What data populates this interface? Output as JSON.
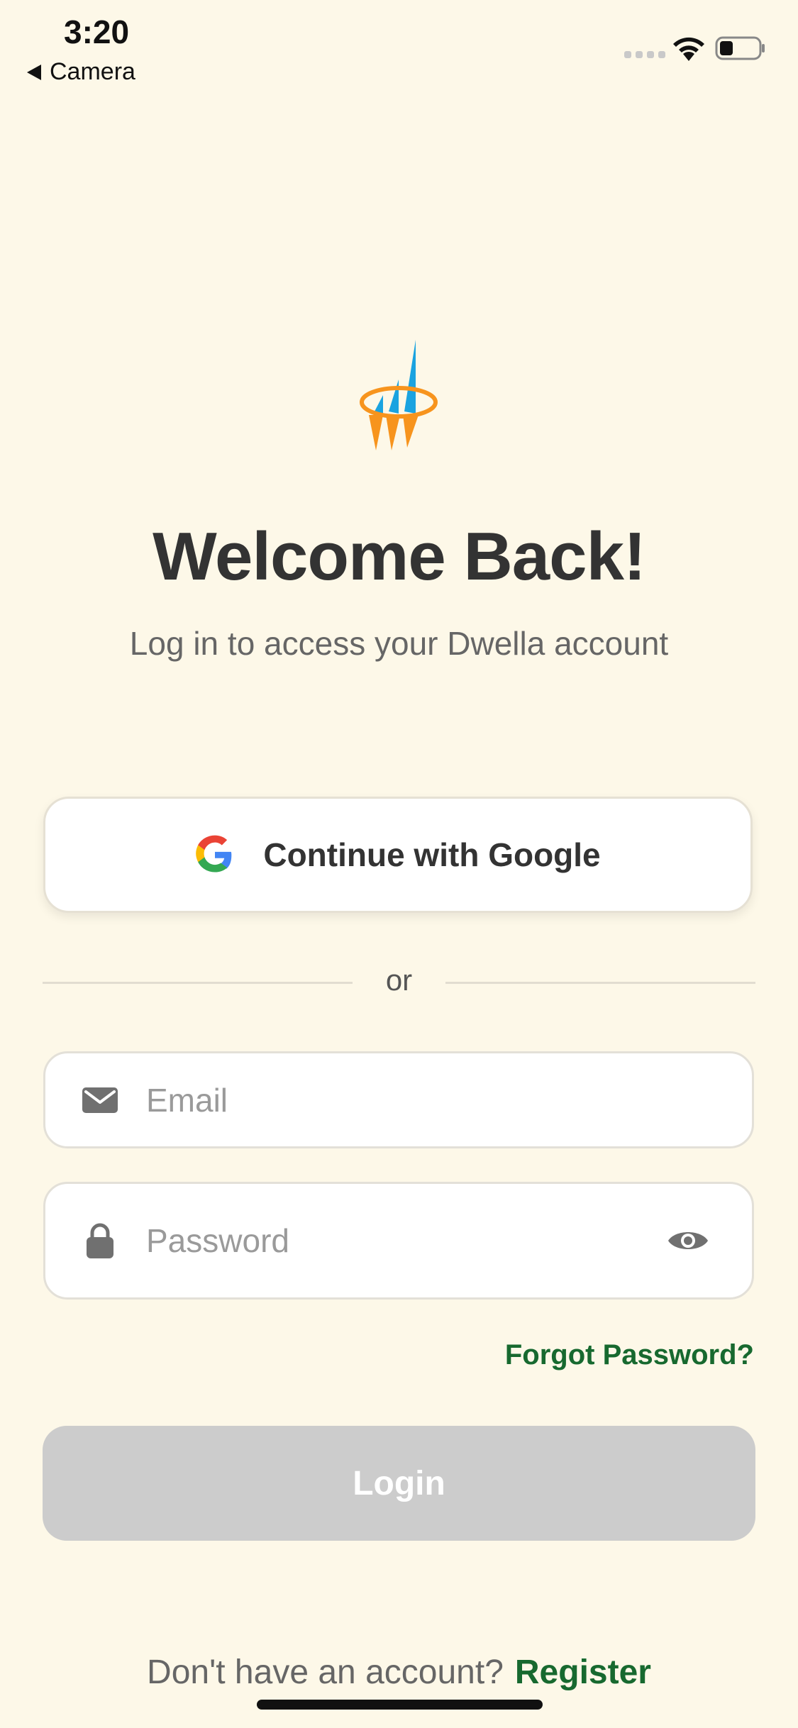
{
  "status_bar": {
    "time": "3:20",
    "back_label": "Camera",
    "battery_level": 0.35
  },
  "colors": {
    "background": "#fdf8e8",
    "accent_green": "#17692f",
    "login_disabled": "#cccccc",
    "logo_blue": "#1aa3e0",
    "logo_orange": "#f7941d"
  },
  "logo": {
    "icon": "dwella-logo"
  },
  "header": {
    "title": "Welcome Back!",
    "subtitle": "Log in to access your Dwella account"
  },
  "google_button": {
    "label": "Continue with Google",
    "icon": "google-icon"
  },
  "divider": {
    "label": "or"
  },
  "form": {
    "email": {
      "value": "",
      "placeholder": "Email",
      "icon": "mail-icon"
    },
    "password": {
      "value": "",
      "placeholder": "Password",
      "icon": "lock-icon",
      "toggle_icon": "eye-icon"
    },
    "forgot_label": "Forgot Password?",
    "login_label": "Login",
    "login_enabled": false
  },
  "footer": {
    "prompt": "Don't have an account?",
    "register_label": "Register"
  }
}
